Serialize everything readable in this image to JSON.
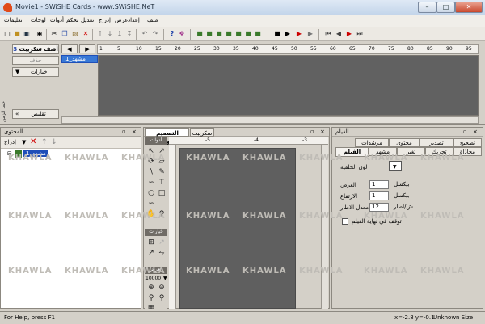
{
  "window": {
    "title": "Movie1 - SWiSHE Cards - www.SWiSHE.NeT",
    "min": "–",
    "max": "□",
    "close": "✕"
  },
  "menu": [
    "تعليمات",
    "لوحات",
    "أدوات",
    "تحكم",
    "تعديل",
    "إدراج",
    "عرض",
    "إعداد",
    "ملف"
  ],
  "toolbar_icons": [
    "new-icon",
    "open-icon",
    "save-icon",
    "find-icon",
    "cut-icon",
    "copy-icon",
    "paste-icon",
    "delete-icon",
    "up-icon",
    "down-icon",
    "top-icon",
    "bottom-icon",
    "undo-icon",
    "redo-icon",
    "help-icon",
    "image-icon",
    "stop-icon",
    "play-icon",
    "record-icon",
    "rewind-icon",
    "back-icon",
    "forward-icon",
    "end-icon"
  ],
  "timeline": {
    "add_script": "أضف سكريبت",
    "delete": "حذف",
    "options": "خيارات",
    "minimize": "تقليص",
    "scene_label": "مشهد_1",
    "ruler": [
      "1",
      "5",
      "10",
      "15",
      "20",
      "25",
      "30",
      "35",
      "40",
      "45",
      "50",
      "55",
      "60",
      "65",
      "70",
      "75",
      "80",
      "85",
      "90",
      "95"
    ],
    "side_label": "خط الزمن"
  },
  "outline": {
    "title": "المحتوى",
    "insert": "إدراج",
    "item": "مشهد_1"
  },
  "stage": {
    "tabs": [
      "سكريبت",
      "التصميم مشهد_1"
    ],
    "tools_header": "أدوات",
    "options_header": "خيارات",
    "view_header": "العرض",
    "zoom": "10000",
    "ruler": [
      "-5",
      "-4",
      "-3"
    ]
  },
  "properties": {
    "title": "الفيلم",
    "tabs_row1": [
      "تصحيح",
      "تصدير",
      "محتوى",
      "مرشدات"
    ],
    "tabs_row2": [
      "محاذاة",
      "تحريك",
      "تغير",
      "مشهد",
      "الفيلم"
    ],
    "bg_label": "لون الخلفية",
    "width_label": "العرض",
    "height_label": "الارتفاع",
    "fps_label": "معدل الاطار",
    "width_value": "1",
    "height_value": "1",
    "fps_value": "12",
    "unit1": "بيكسل",
    "unit2": "بيكسل",
    "unit3": "ش/اطار",
    "stop_label": "توقف في نهاية الفيلم"
  },
  "watermark": "KHAWLA",
  "status": {
    "help": "For Help, press F1",
    "coords": "x=-2.8 y=-0.1",
    "size": "Unknown Size"
  },
  "colors": {
    "stage": "#5f5f5f",
    "selected": "#1f4fb8",
    "scene_bg": "#3878d6"
  }
}
